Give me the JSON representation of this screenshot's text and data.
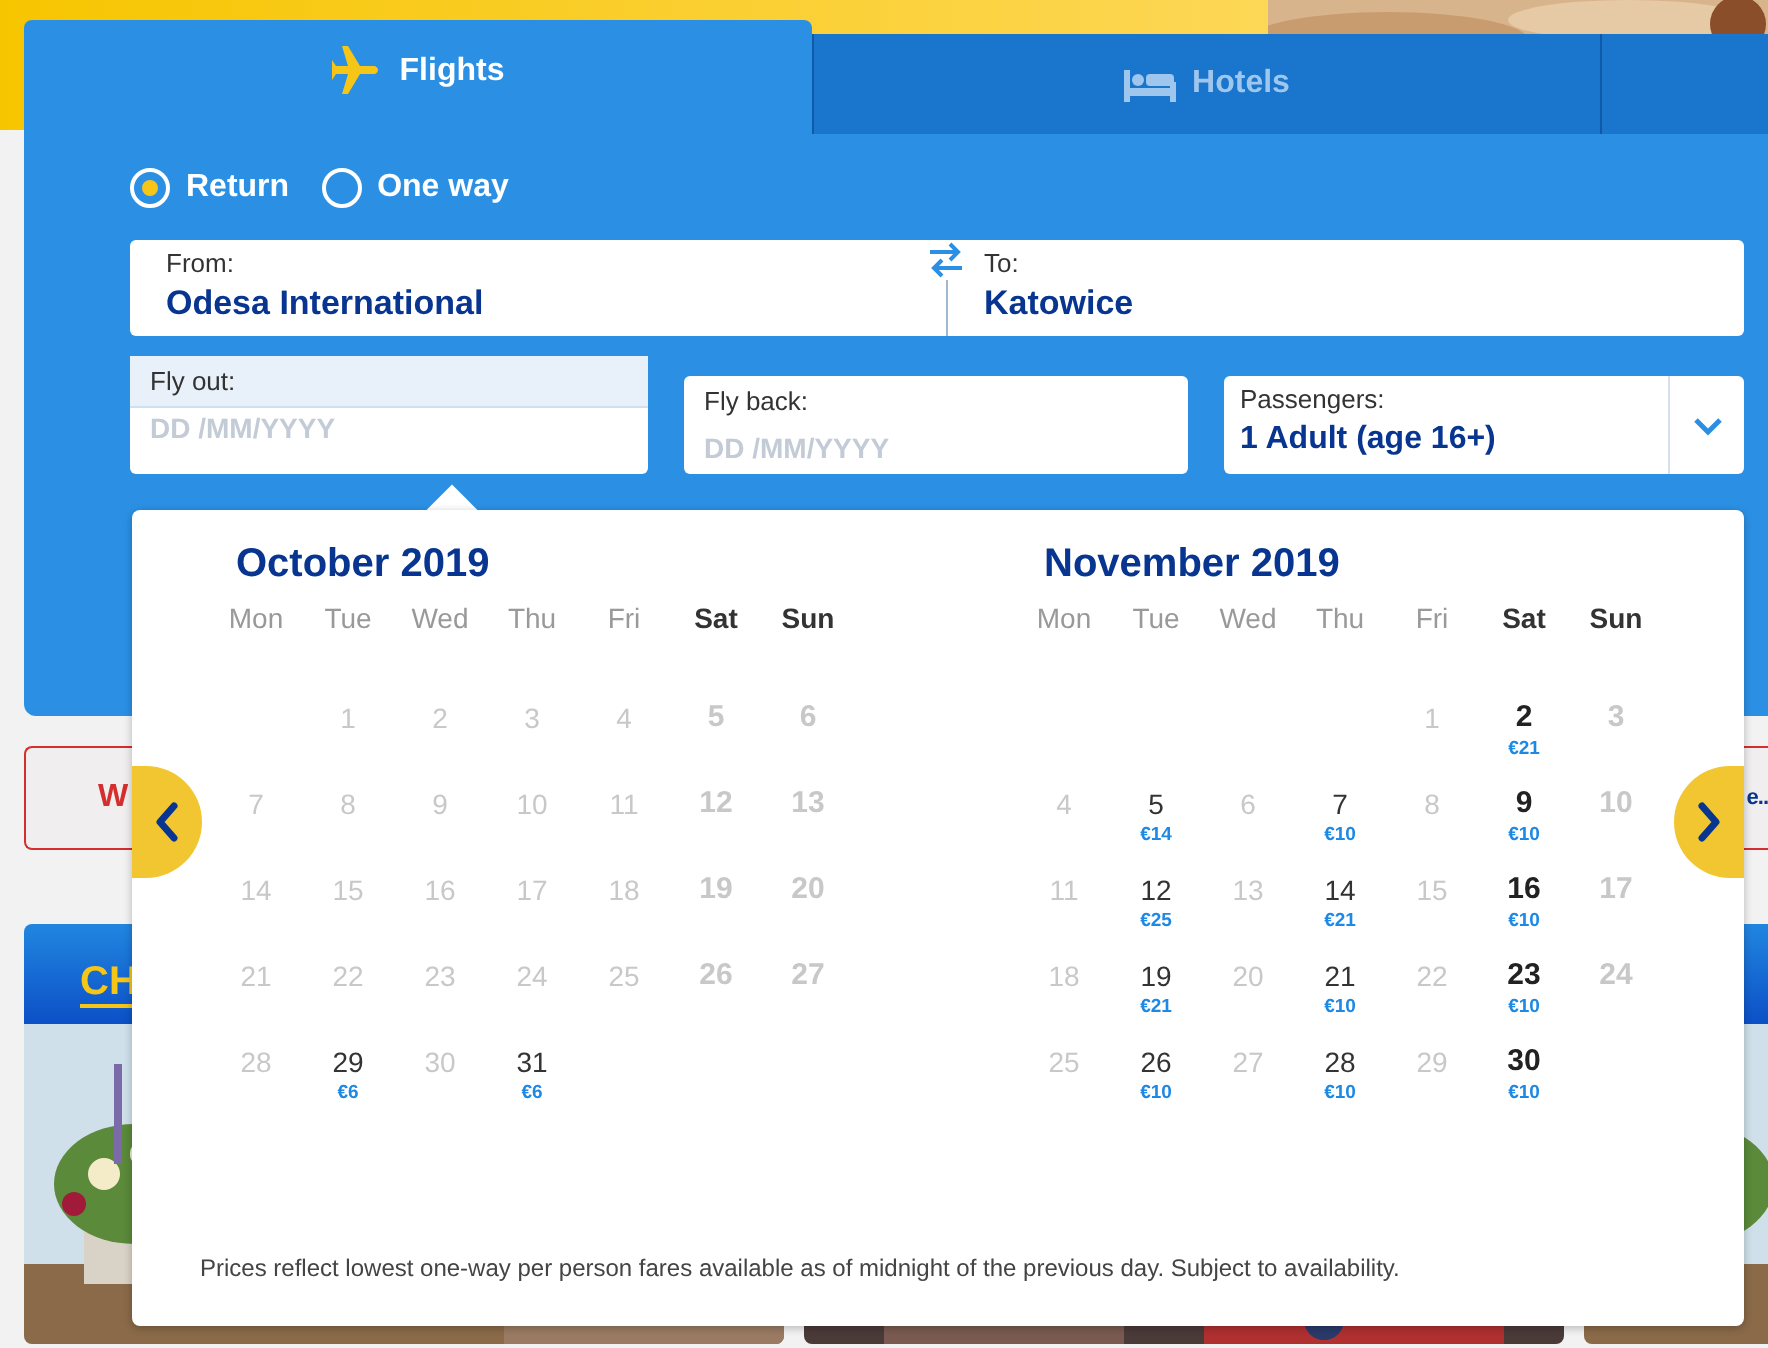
{
  "tabs": [
    {
      "kind": "flights",
      "label": "Flights",
      "selected": true
    },
    {
      "kind": "hotels",
      "label": "Hotels",
      "selected": false
    },
    {
      "kind": "more",
      "selected": false
    }
  ],
  "trip_type": [
    {
      "label": "Return",
      "selected": true
    },
    {
      "label": "One way",
      "selected": false
    }
  ],
  "route": {
    "from": {
      "label": "From:",
      "value": "Odesa International"
    },
    "to": {
      "label": "To:",
      "value": "Katowice"
    }
  },
  "dates": [
    {
      "label": "Fly out:",
      "placeholder": "DD /MM/YYYY",
      "focused": true
    },
    {
      "label": "Fly back:",
      "placeholder": "DD /MM/YYYY",
      "focused": false
    }
  ],
  "passengers": {
    "label": "Passengers:",
    "value": "1 Adult (age 16+)"
  },
  "banner": {
    "left_text": "W",
    "right_text": "e.."
  },
  "promos": [
    {
      "title": "CH"
    }
  ],
  "calendar": {
    "months": [
      {
        "title": "October 2019",
        "weekdays": [
          "Mon",
          "Tue",
          "Wed",
          "Thu",
          "Fri",
          "Sat",
          "Sun"
        ],
        "weeks": [
          [
            {
              "day": "1",
              "available": false
            },
            {
              "day": "2",
              "available": false
            },
            {
              "day": "3",
              "available": false
            },
            {
              "day": "4",
              "available": false
            },
            {
              "day": "5",
              "available": false
            },
            {
              "day": "6",
              "available": false
            }
          ],
          [
            {
              "day": "7",
              "available": false
            },
            {
              "day": "8",
              "available": false
            },
            {
              "day": "9",
              "available": false
            },
            {
              "day": "10",
              "available": false
            },
            {
              "day": "11",
              "available": false
            },
            {
              "day": "12",
              "available": false
            },
            {
              "day": "13",
              "available": false
            }
          ],
          [
            {
              "day": "14",
              "available": false
            },
            {
              "day": "15",
              "available": false
            },
            {
              "day": "16",
              "available": false
            },
            {
              "day": "17",
              "available": false
            },
            {
              "day": "18",
              "available": false
            },
            {
              "day": "19",
              "available": false
            },
            {
              "day": "20",
              "available": false
            }
          ],
          [
            {
              "day": "21",
              "available": false
            },
            {
              "day": "22",
              "available": false
            },
            {
              "day": "23",
              "available": false
            },
            {
              "day": "24",
              "available": false
            },
            {
              "day": "25",
              "available": false
            },
            {
              "day": "26",
              "available": false
            },
            {
              "day": "27",
              "available": false
            }
          ],
          [
            {
              "day": "28",
              "available": false
            },
            {
              "day": "29",
              "available": true,
              "price": "€6"
            },
            {
              "day": "30",
              "available": false
            },
            {
              "day": "31",
              "available": true,
              "price": "€6"
            }
          ]
        ]
      },
      {
        "title": "November 2019",
        "weekdays": [
          "Mon",
          "Tue",
          "Wed",
          "Thu",
          "Fri",
          "Sat",
          "Sun"
        ],
        "weeks": [
          [
            {
              "day": "1",
              "available": false
            },
            {
              "day": "2",
              "available": true,
              "price": "€21"
            },
            {
              "day": "3",
              "available": false
            }
          ],
          [
            {
              "day": "4",
              "available": false
            },
            {
              "day": "5",
              "available": true,
              "price": "€14"
            },
            {
              "day": "6",
              "available": false
            },
            {
              "day": "7",
              "available": true,
              "price": "€10"
            },
            {
              "day": "8",
              "available": false
            },
            {
              "day": "9",
              "available": true,
              "price": "€10"
            },
            {
              "day": "10",
              "available": false
            }
          ],
          [
            {
              "day": "11",
              "available": false
            },
            {
              "day": "12",
              "available": true,
              "price": "€25"
            },
            {
              "day": "13",
              "available": false
            },
            {
              "day": "14",
              "available": true,
              "price": "€21"
            },
            {
              "day": "15",
              "available": false
            },
            {
              "day": "16",
              "available": true,
              "price": "€10"
            },
            {
              "day": "17",
              "available": false
            }
          ],
          [
            {
              "day": "18",
              "available": false
            },
            {
              "day": "19",
              "available": true,
              "price": "€21"
            },
            {
              "day": "20",
              "available": false
            },
            {
              "day": "21",
              "available": true,
              "price": "€10"
            },
            {
              "day": "22",
              "available": false
            },
            {
              "day": "23",
              "available": true,
              "price": "€10"
            },
            {
              "day": "24",
              "available": false
            }
          ],
          [
            {
              "day": "25",
              "available": false
            },
            {
              "day": "26",
              "available": true,
              "price": "€10"
            },
            {
              "day": "27",
              "available": false
            },
            {
              "day": "28",
              "available": true,
              "price": "€10"
            },
            {
              "day": "29",
              "available": false
            },
            {
              "day": "30",
              "available": true,
              "price": "€10"
            }
          ]
        ]
      }
    ],
    "note": "Prices reflect lowest one-way per person fares available as of midnight of the previous day. Subject to availability."
  }
}
